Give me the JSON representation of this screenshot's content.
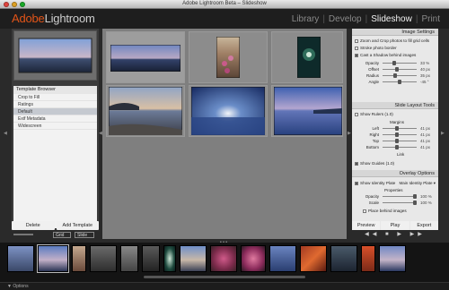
{
  "window": {
    "title": "Adobe Lightroom Beta – Slideshow"
  },
  "app": {
    "logo_part1": "Adobe",
    "logo_part2": "Lightroom"
  },
  "modules": [
    {
      "label": "Library",
      "active": false
    },
    {
      "label": "Develop",
      "active": false
    },
    {
      "label": "Slideshow",
      "active": true
    },
    {
      "label": "Print",
      "active": false
    }
  ],
  "template_browser": {
    "title": "Template Browser",
    "items": [
      {
        "label": "Crop to Fill",
        "selected": false
      },
      {
        "label": "Ratings",
        "selected": false
      },
      {
        "label": "Default",
        "selected": true
      },
      {
        "label": "Exif Metadata",
        "selected": false
      },
      {
        "label": "Widescreen",
        "selected": false
      }
    ]
  },
  "left_buttons": {
    "delete": "Delete",
    "add": "Add Template"
  },
  "toolbar": {
    "grid": "Grid",
    "slide": "Slide"
  },
  "image_settings": {
    "title": "Image Settings",
    "zoom_label": "Zoom and Crop photos to fill grid cells",
    "stroke_label": "Stroke photo border",
    "shadow_label": "Cast a Shadow behind images",
    "sliders": [
      {
        "label": "Opacity",
        "value": "33 %",
        "pos": 0.33
      },
      {
        "label": "Offset",
        "value": "40 px",
        "pos": 0.4
      },
      {
        "label": "Radius",
        "value": "35 px",
        "pos": 0.35
      },
      {
        "label": "Angle",
        "value": "-45 °",
        "pos": 0.5
      }
    ]
  },
  "slide_layout": {
    "title": "Slide Layout Tools",
    "show_rulers": "Show Rulers",
    "ruler_unit": "(1.0)",
    "margins_label": "Margins",
    "sliders": [
      {
        "label": "Left",
        "value": "41 px",
        "pos": 0.41
      },
      {
        "label": "Right",
        "value": "41 px",
        "pos": 0.41
      },
      {
        "label": "Top",
        "value": "41 px",
        "pos": 0.41
      },
      {
        "label": "Bottom",
        "value": "41 px",
        "pos": 0.41
      }
    ],
    "link_label": "Link",
    "show_guides": "Show Guides",
    "guides_unit": "(1.0)"
  },
  "overlay": {
    "title": "Overlay Options",
    "identity_plate": "Show Identity Plate",
    "identity_value": "Main Identity Plate ▾",
    "properties_label": "Properties",
    "sliders": [
      {
        "label": "Opacity",
        "value": "100 %",
        "pos": 1.0
      },
      {
        "label": "Scale",
        "value": "100 %",
        "pos": 1.0
      }
    ],
    "place_behind": "Place behind images"
  },
  "right_buttons": {
    "preview": "Preview",
    "play": "Play",
    "export": "Export"
  },
  "playback": {
    "controls": "◀◀  ■  ▶  ▶▶"
  },
  "status": {
    "left": "▼ Options"
  },
  "colors": {
    "accent": "#e25418",
    "panel_dark": "#3b3b3b",
    "center_bg": "#7f7f7f"
  }
}
